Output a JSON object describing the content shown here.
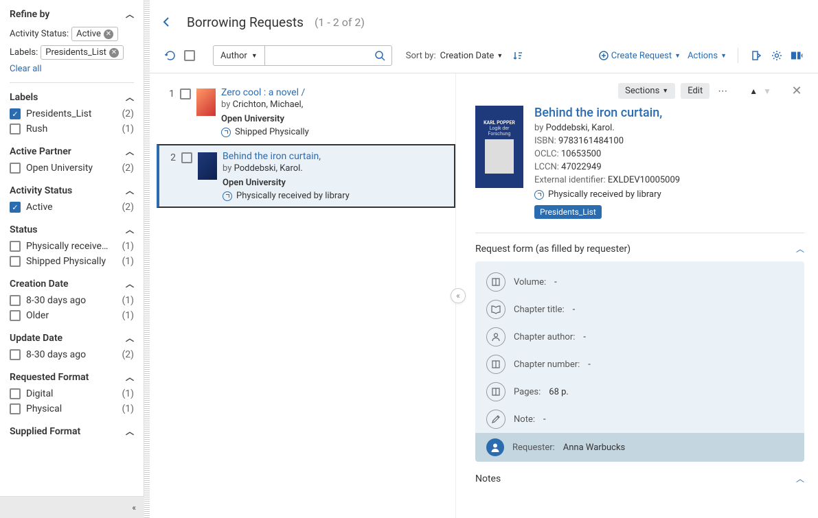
{
  "sidebar": {
    "refine_title": "Refine by",
    "chips": [
      {
        "label": "Activity Status:",
        "value": "Active"
      },
      {
        "label": "Labels:",
        "value": "Presidents_List"
      }
    ],
    "clear_all": "Clear all",
    "facets": [
      {
        "title": "Labels",
        "items": [
          {
            "label": "Presidents_List",
            "count": "(2)",
            "checked": true
          },
          {
            "label": "Rush",
            "count": "(1)",
            "checked": false
          }
        ]
      },
      {
        "title": "Active Partner",
        "items": [
          {
            "label": "Open University",
            "count": "(2)",
            "checked": false
          }
        ]
      },
      {
        "title": "Activity Status",
        "items": [
          {
            "label": "Active",
            "count": "(2)",
            "checked": true
          }
        ]
      },
      {
        "title": "Status",
        "items": [
          {
            "label": "Physically receive…",
            "count": "(1)",
            "checked": false
          },
          {
            "label": "Shipped Physically",
            "count": "(1)",
            "checked": false
          }
        ]
      },
      {
        "title": "Creation Date",
        "items": [
          {
            "label": "8-30 days ago",
            "count": "(1)",
            "checked": false
          },
          {
            "label": "Older",
            "count": "(1)",
            "checked": false
          }
        ]
      },
      {
        "title": "Update Date",
        "items": [
          {
            "label": "8-30 days ago",
            "count": "(2)",
            "checked": false
          }
        ]
      },
      {
        "title": "Requested Format",
        "items": [
          {
            "label": "Digital",
            "count": "(1)",
            "checked": false
          },
          {
            "label": "Physical",
            "count": "(1)",
            "checked": false
          }
        ]
      },
      {
        "title": "Supplied Format",
        "items": []
      }
    ]
  },
  "header": {
    "title": "Borrowing Requests",
    "count": "(1 - 2 of 2)"
  },
  "toolbar": {
    "search_field": "Author",
    "search_placeholder": "",
    "sort_label": "Sort by:",
    "sort_value": "Creation Date",
    "create_request": "Create Request",
    "actions": "Actions"
  },
  "list": {
    "items": [
      {
        "num": "1",
        "title": "Zero cool : a novel /",
        "by_label": "by",
        "author": "Crichton, Michael,",
        "library": "Open University",
        "status": "Shipped Physically",
        "thumb": "orange",
        "selected": false
      },
      {
        "num": "2",
        "title": "Behind the iron curtain,",
        "by_label": "by",
        "author": "Poddebski, Karol.",
        "library": "Open University",
        "status": "Physically received by library",
        "thumb": "blue",
        "selected": true
      }
    ]
  },
  "detail": {
    "sections_btn": "Sections",
    "edit_btn": "Edit",
    "title": "Behind the iron curtain,",
    "by_label": "by",
    "author": "Poddebski, Karol.",
    "thumb_top": "KARL POPPER",
    "thumb_sub": "Logik der Forschung",
    "meta": [
      {
        "label": "ISBN:",
        "value": "9783161484100"
      },
      {
        "label": "OCLC:",
        "value": "10653500"
      },
      {
        "label": "LCCN:",
        "value": "47022949"
      },
      {
        "label": "External identifier:",
        "value": "EXLDEV10005009"
      }
    ],
    "status": "Physically received by library",
    "label_chip": "Presidents_List",
    "form_section_title": "Request form (as filled by requester)",
    "form_rows": [
      {
        "icon": "book",
        "label": "Volume:",
        "value": "-"
      },
      {
        "icon": "book-open",
        "label": "Chapter title:",
        "value": "-"
      },
      {
        "icon": "person",
        "label": "Chapter author:",
        "value": "-"
      },
      {
        "icon": "book",
        "label": "Chapter number:",
        "value": "-"
      },
      {
        "icon": "book",
        "label": "Pages:",
        "value": "68 p."
      },
      {
        "icon": "pencil",
        "label": "Note:",
        "value": "-"
      }
    ],
    "requester_label": "Requester:",
    "requester_value": "Anna Warbucks",
    "notes_section_title": "Notes"
  }
}
